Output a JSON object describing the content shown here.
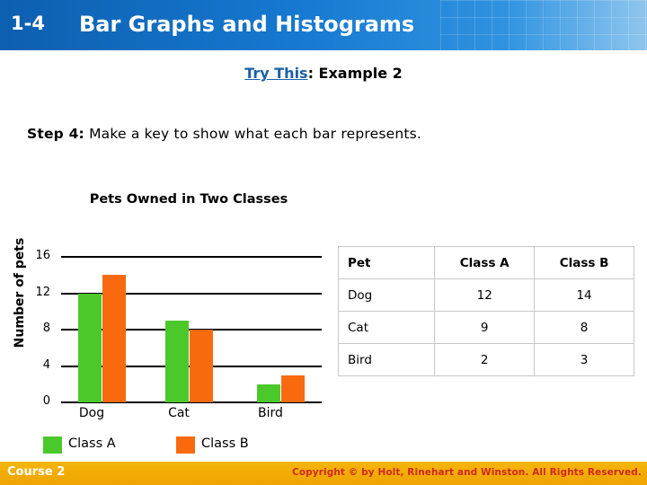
{
  "header": {
    "lesson_number": "1-4",
    "title": "Bar Graphs and Histograms"
  },
  "subtitle": {
    "link_text": "Try This",
    "rest_text": ": Example 2"
  },
  "step": {
    "label": "Step 4:",
    "text": " Make a key to show what each bar represents."
  },
  "chart_data": {
    "type": "bar",
    "title": "Pets Owned in Two Classes",
    "xlabel": "",
    "ylabel": "Number of pets",
    "categories": [
      "Dog",
      "Cat",
      "Bird"
    ],
    "series": [
      {
        "name": "Class A",
        "color": "#4bc92b",
        "values": [
          12,
          9,
          2
        ]
      },
      {
        "name": "Class B",
        "color": "#f96a0f",
        "values": [
          14,
          8,
          3
        ]
      }
    ],
    "yticks": [
      "0",
      "4",
      "8",
      "12",
      "16"
    ],
    "ylim": [
      0,
      18
    ],
    "grid": true,
    "legend_position": "bottom"
  },
  "table": {
    "headers": [
      "Pet",
      "Class A",
      "Class B"
    ],
    "rows": [
      [
        "Dog",
        "12",
        "14"
      ],
      [
        "Cat",
        "9",
        "8"
      ],
      [
        "Bird",
        "2",
        "3"
      ]
    ]
  },
  "footer": {
    "course": "Course 2",
    "copyright": "Copyright © by Holt, Rinehart and Winston. All Rights Reserved."
  }
}
